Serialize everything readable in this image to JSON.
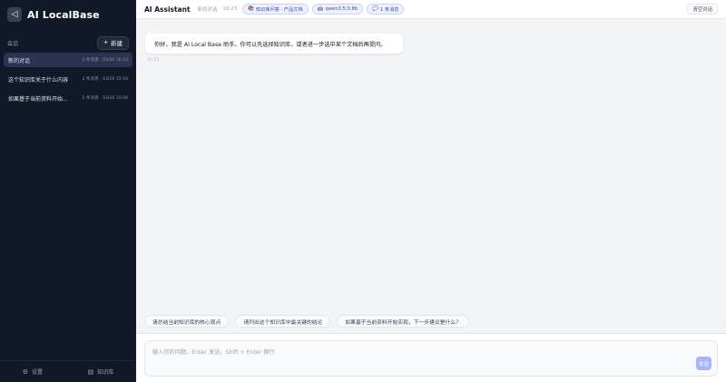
{
  "sidebar": {
    "brand_icon": "◁",
    "brand_title": "AI LocalBase",
    "section_label": "会话",
    "new_button": {
      "icon": "+",
      "label": "新建"
    },
    "conversations": [
      {
        "title": "新的对话",
        "meta": "1 条消息 · 03/26 16:23",
        "active": true
      },
      {
        "title": "这个知识库关于什么内容",
        "meta": "2 条消息 · 03/26 15:16",
        "active": false
      },
      {
        "title": "如果基于当前资料开始...",
        "meta": "2 条消息 · 03/26 15:08",
        "active": false
      }
    ],
    "footer": {
      "settings": {
        "icon": "⚙",
        "label": "设置"
      },
      "kb": {
        "icon": "▤",
        "label": "知识库"
      }
    }
  },
  "topbar": {
    "app_name": "AI Assistant",
    "subtitle": "新的对话",
    "separator": "·",
    "time": "16:23",
    "chips": [
      {
        "icon": "📚",
        "label": "知识库问答 · 产品文档"
      },
      {
        "icon": "🤖",
        "label": "qwen3.5:0.8b"
      },
      {
        "icon": "💬",
        "label": "1 条消息"
      }
    ],
    "clear_label": "清空对话"
  },
  "chat": {
    "message": "你好，我是 AI Local Base 助手。你可以先选择知识库，或者进一步选中某个文档后再提问。",
    "time": "16:23"
  },
  "suggestions": [
    "请总结当前知识库的核心观点",
    "请列出这个知识库中最关键的结论",
    "如果基于当前资料开始实现，下一步建议是什么？"
  ],
  "composer": {
    "placeholder": "输入你的问题。Enter 发送，Shift + Enter 换行",
    "send_label": "发送"
  },
  "colors": {
    "sidebar_bg": "#111827",
    "active_item": "#2b3350",
    "accent": "#a5b4fc"
  }
}
